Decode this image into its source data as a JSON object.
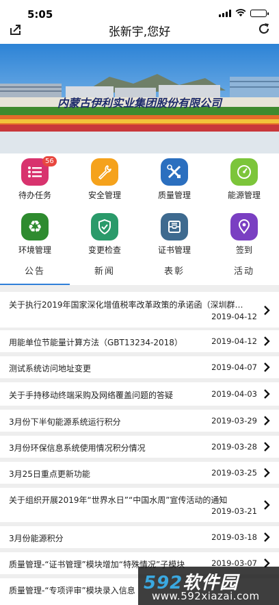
{
  "status_bar": {
    "time": "5:05"
  },
  "nav": {
    "title": "张新宇,您好"
  },
  "banner": {
    "company_sign": "内蒙古伊利实业集团股份有限公司"
  },
  "grid": [
    {
      "label": "待办任务",
      "icon": "list-icon",
      "color": "#d8336e",
      "badge": "56"
    },
    {
      "label": "安全管理",
      "icon": "wrench-icon",
      "color": "#f5a21c"
    },
    {
      "label": "质量管理",
      "icon": "tools-icon",
      "color": "#2b6fbf"
    },
    {
      "label": "能源管理",
      "icon": "gauge-icon",
      "color": "#7cc53a"
    },
    {
      "label": "环境管理",
      "icon": "recycle-icon",
      "color": "#2e8b2f"
    },
    {
      "label": "变更检查",
      "icon": "shield-check-icon",
      "color": "#2a9a6a"
    },
    {
      "label": "证书管理",
      "icon": "inbox-icon",
      "color": "#3e6a8f"
    },
    {
      "label": "签到",
      "icon": "location-pin-icon",
      "color": "#7a3fc2"
    }
  ],
  "tabs": [
    "公告",
    "新闻",
    "表彰",
    "活动"
  ],
  "news": [
    {
      "title": "关于执行2019年国家深化增值税率改革政策的承诺函（深圳群…",
      "date": "2019-04-12"
    },
    {
      "title": "用能单位节能量计算方法（GBT13234-2018）",
      "date": "2019-04-12"
    },
    {
      "title": "测试系统访问地址变更",
      "date": "2019-04-07"
    },
    {
      "title": "关于手持移动终端采购及网络覆盖问题的答疑",
      "date": "2019-04-03"
    },
    {
      "title": "3月份下半旬能源系统运行积分",
      "date": "2019-03-29"
    },
    {
      "title": "3月份环保信息系统使用情况积分情况",
      "date": "2019-03-28"
    },
    {
      "title": "3月25日重点更新功能",
      "date": "2019-03-25"
    },
    {
      "title": "关于组织开展2019年“世界水日”“中国水周”宣传活动的通知",
      "date": "2019-03-21"
    },
    {
      "title": "3月份能源积分",
      "date": "2019-03-18"
    },
    {
      "title": "质量管理-“证书管理”模块增加“特殊情况”子模块",
      "date": "2019-03-07"
    },
    {
      "title": "质量管理-“专项评审”模块录入信息",
      "date": ""
    }
  ],
  "watermark": {
    "brand_num": "592",
    "brand_text": "软件园",
    "url": "www.592xiazai.com"
  }
}
